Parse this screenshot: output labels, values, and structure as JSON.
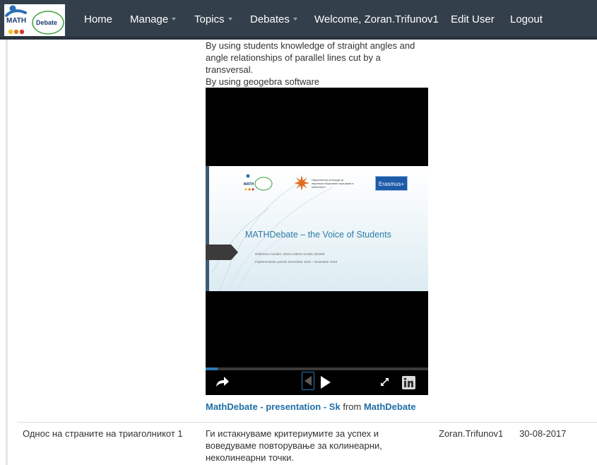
{
  "brand": {
    "logo_text_math": "MATH",
    "logo_text_debate": "Debate"
  },
  "nav": {
    "home": "Home",
    "manage": "Manage",
    "topics": "Topics",
    "debates": "Debates",
    "welcome": "Welcome, Zoran.Trifunov1",
    "edit_user": "Edit User",
    "logout": "Logout"
  },
  "description": {
    "line1": "By using students knowledge of straight angles and angle relationships of parallel lines cut by a transversal.",
    "line2": "By using geogebra software"
  },
  "slide": {
    "title": "MATHDebate – the Voice of Students",
    "reference": "Reference number: 2016-1-MK01-KA201-021659",
    "period": "Implementation period: December 2016 – November 2018",
    "agency": "Национална агенција за европски образовни програми и мобилност",
    "erasmus": "Erasmus+",
    "progress": 0.055
  },
  "video_controls": {
    "share_icon": "share-icon",
    "prev_icon": "prev-slide-icon",
    "next_icon": "play-next-icon",
    "fullscreen_icon": "fullscreen-icon",
    "linkedin_icon": "linkedin-icon"
  },
  "embed_caption": {
    "presentation_link": "MathDebate - presentation - Sk",
    "from": "from",
    "author_link": "MathDebate"
  },
  "table_row": {
    "topic": "Однос на страните на триаголникот 1",
    "description": "Ги истакнуваме критериумите за успех и воведуваме повторување за колинеарни, неколинеарни точки.",
    "author": "Zoran.Trifunov1",
    "date": "30-08-2017"
  },
  "colors": {
    "navbar": "#333f4b",
    "link": "#1f6fa8",
    "slide_title": "#2e7ca8"
  }
}
